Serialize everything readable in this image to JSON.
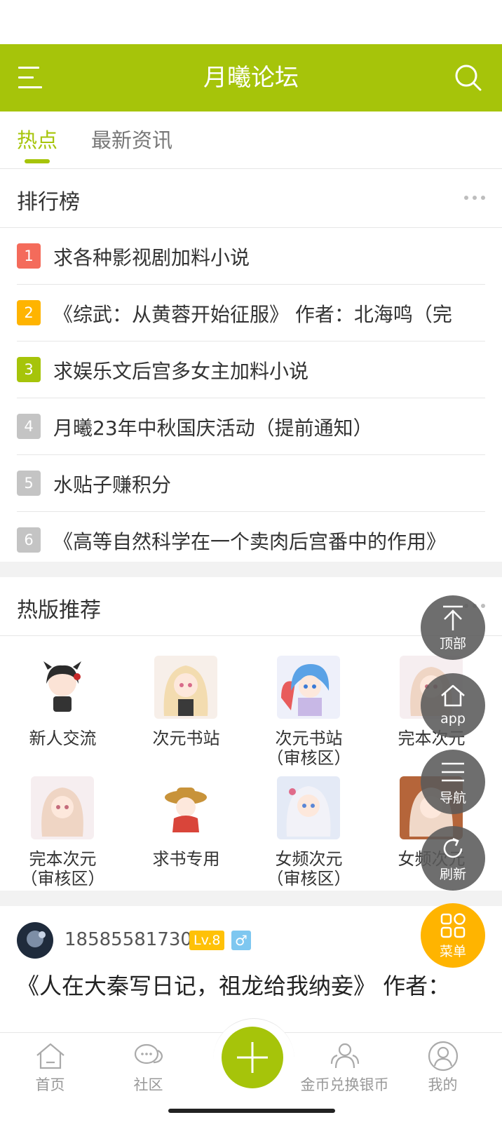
{
  "app": {
    "title": "月曦论坛",
    "accent_color": "#a6c40a"
  },
  "tabs": [
    {
      "label": "热点",
      "active": true
    },
    {
      "label": "最新资讯",
      "active": false
    }
  ],
  "ranking": {
    "title": "排行榜",
    "items": [
      {
        "rank": "1",
        "color": "#f46b5b",
        "text": "求各种影视剧加料小说"
      },
      {
        "rank": "2",
        "color": "#ffb400",
        "text": "《综武：从黄蓉开始征服》 作者：北海鸣（完"
      },
      {
        "rank": "3",
        "color": "#a6c40a",
        "text": "求娱乐文后宫多女主加料小说"
      },
      {
        "rank": "4",
        "color": "#c4c4c4",
        "text": "月曦23年中秋国庆活动（提前通知）"
      },
      {
        "rank": "5",
        "color": "#c4c4c4",
        "text": "水贴子赚积分"
      },
      {
        "rank": "6",
        "color": "#c4c4c4",
        "text": "《高等自然科学在一个卖肉后宫番中的作用》"
      }
    ]
  },
  "hot_forums": {
    "title": "热版推荐",
    "items": [
      {
        "name": "新人交流",
        "sub": "",
        "icon": "anime-girl-dark-hair-icon"
      },
      {
        "name": "次元书站",
        "sub": "",
        "icon": "anime-girl-blonde-icon"
      },
      {
        "name": "次元书站",
        "sub": "（审核区）",
        "icon": "anime-girl-blue-hair-icon"
      },
      {
        "name": "完本次元",
        "sub": "",
        "icon": "anime-girl-pink-icon"
      },
      {
        "name": "完本次元",
        "sub": "（审核区）",
        "icon": "anime-girl-pink-icon"
      },
      {
        "name": "求书专用",
        "sub": "",
        "icon": "anime-chibi-hat-icon"
      },
      {
        "name": "女频次元",
        "sub": "（审核区）",
        "icon": "anime-girl-white-hair-icon"
      },
      {
        "name": "女频次元",
        "sub": "",
        "icon": "anime-girl-brown-icon"
      }
    ]
  },
  "post": {
    "username": "18585581730",
    "level": "Lv.8",
    "gender_symbol": "♂",
    "title": "《人在大秦写日记，祖龙给我纳妾》 作者："
  },
  "float_buttons": [
    {
      "label": "顶部",
      "icon": "arrow-to-top-icon"
    },
    {
      "label": "app",
      "icon": "home-icon"
    },
    {
      "label": "导航",
      "icon": "menu-lines-icon"
    },
    {
      "label": "刷新",
      "icon": "refresh-icon"
    },
    {
      "label": "菜单",
      "icon": "grid-icon"
    }
  ],
  "bottom_nav": [
    {
      "label": "首页",
      "icon": "home-icon"
    },
    {
      "label": "社区",
      "icon": "chat-bubbles-icon"
    },
    {
      "label": "",
      "icon": "plus-icon"
    },
    {
      "label": "金币兑换银币",
      "icon": "users-icon"
    },
    {
      "label": "我的",
      "icon": "user-icon"
    }
  ]
}
